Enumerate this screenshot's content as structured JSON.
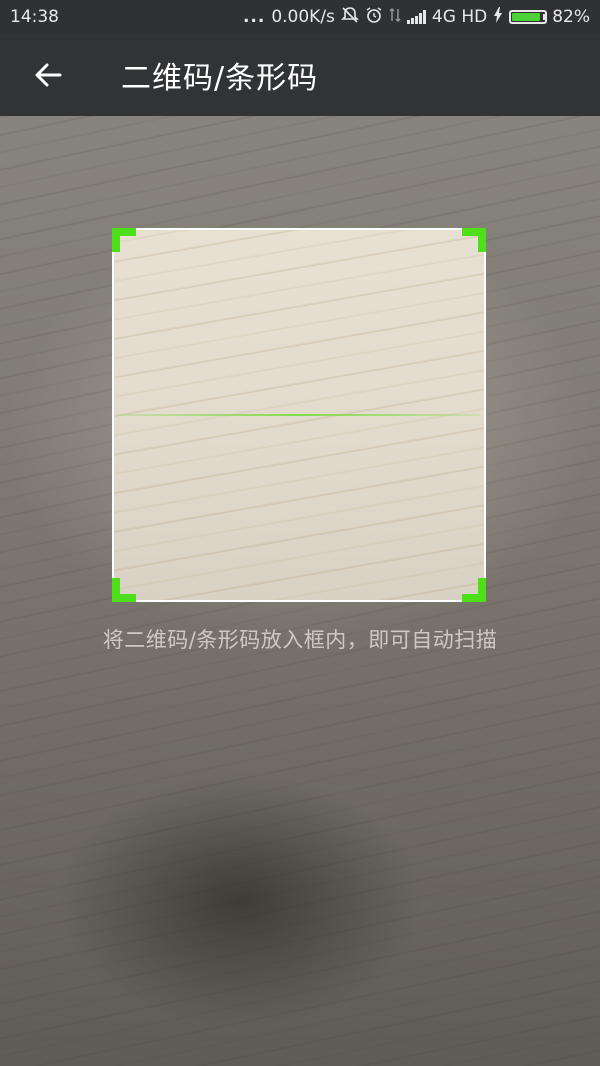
{
  "status_bar": {
    "time": "14:38",
    "indicators_dots": "...",
    "net_speed": "0.00K/s",
    "network": "4G HD",
    "battery_text": "82%",
    "battery_level": 0.82,
    "icons": [
      "notification-off-icon",
      "alarm-icon",
      "data-transfer-icon",
      "signal-icon",
      "charging-icon",
      "battery-icon"
    ]
  },
  "header": {
    "back_icon": "arrow-left-icon",
    "title": "二维码/条形码"
  },
  "scanner": {
    "hint": "将二维码/条形码放入框内，即可自动扫描",
    "accent_color": "#4de01a"
  }
}
